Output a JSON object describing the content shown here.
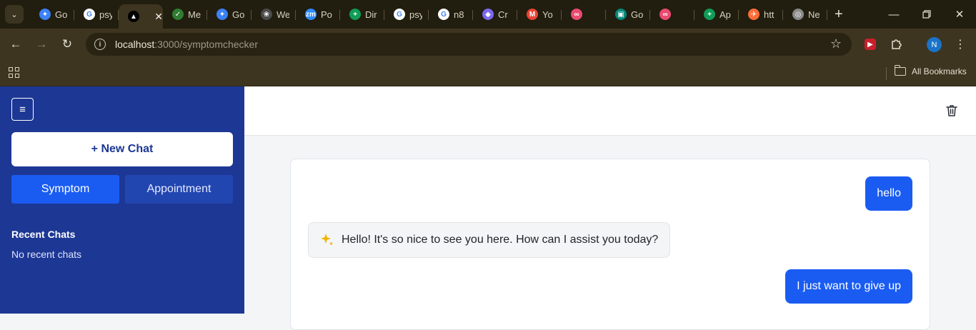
{
  "browser": {
    "tabs": [
      {
        "title": "Go",
        "favicon": "gemini-icon",
        "color": "#3b82f6",
        "glyph": "✦"
      },
      {
        "title": "psy",
        "favicon": "google-icon",
        "color": "#ffffff",
        "glyph": "G"
      },
      {
        "title": "",
        "favicon": "vercel-icon",
        "color": "#000000",
        "glyph": "▲",
        "active": true
      },
      {
        "title": "Me",
        "favicon": "meet-icon",
        "color": "#2e7d32",
        "glyph": "✓"
      },
      {
        "title": "Go",
        "favicon": "gemini-icon",
        "color": "#3b82f6",
        "glyph": "✦"
      },
      {
        "title": "We",
        "favicon": "openai-icon",
        "color": "#4a4a4a",
        "glyph": "❀"
      },
      {
        "title": "Po",
        "favicon": "zoom-icon",
        "color": "#2d8cff",
        "glyph": "zm"
      },
      {
        "title": "Dir",
        "favicon": "sheets-icon",
        "color": "#0f9d58",
        "glyph": "+"
      },
      {
        "title": "psy",
        "favicon": "google-icon",
        "color": "#ffffff",
        "glyph": "G"
      },
      {
        "title": "n8",
        "favicon": "google-icon",
        "color": "#ffffff",
        "glyph": "G"
      },
      {
        "title": "Cr",
        "favicon": "clickup-icon",
        "color": "#7b68ee",
        "glyph": "◆"
      },
      {
        "title": "Yo",
        "favicon": "gmail-icon",
        "color": "#ea4335",
        "glyph": "M"
      },
      {
        "title": "",
        "favicon": "n8n-icon",
        "color": "#ea4b71",
        "glyph": "∞"
      },
      {
        "title": "Go",
        "favicon": "meet-icon",
        "color": "#00897b",
        "glyph": "▣"
      },
      {
        "title": "",
        "favicon": "n8n-icon",
        "color": "#ea4b71",
        "glyph": "∞"
      },
      {
        "title": "Ap",
        "favicon": "sheets-icon",
        "color": "#0f9d58",
        "glyph": "+"
      },
      {
        "title": "htt",
        "favicon": "postman-icon",
        "color": "#ff6c37",
        "glyph": "✈"
      },
      {
        "title": "Ne",
        "favicon": "chrome-icon",
        "color": "#8a8a8a",
        "glyph": "◎"
      }
    ],
    "url_host": "localhost",
    "url_path": ":3000/symptomchecker",
    "profile_initial": "N",
    "bookmarks_label": "All Bookmarks"
  },
  "sidebar": {
    "new_chat_label": "+ New Chat",
    "mode_symptom_label": "Symptom",
    "mode_appointment_label": "Appointment",
    "recent_title": "Recent Chats",
    "recent_empty": "No recent chats"
  },
  "chat": {
    "messages": [
      {
        "role": "user",
        "text": "hello"
      },
      {
        "role": "assistant",
        "text": "Hello! It's so nice to see you here. How can I assist you today?"
      },
      {
        "role": "user",
        "text": "I just want to give up"
      }
    ]
  },
  "colors": {
    "sidebar": "#1d3794",
    "accent": "#1a5cf2",
    "browser_frame": "#3e3520",
    "sparkle": "#f5b300"
  }
}
